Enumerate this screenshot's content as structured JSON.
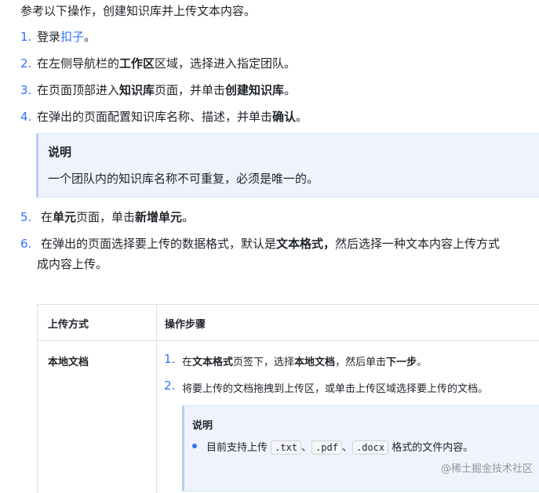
{
  "intro": "参考以下操作，创建知识库并上传文本内容。",
  "steps": [
    {
      "num": "1.",
      "a": "登录",
      "link": "扣子",
      "b": "。"
    },
    {
      "num": "2.",
      "a": "在左侧导航栏的",
      "strong": "工作区",
      "b": "区域，选择进入指定团队。"
    },
    {
      "num": "3.",
      "a": "在页面顶部进入",
      "strong1": "知识库",
      "b": "页面，并单击",
      "strong2": "创建知识库",
      "c": "。"
    },
    {
      "num": "4.",
      "a": "在弹出的页面配置知识库名称、描述，并单击",
      "strong": "确认",
      "b": "。"
    },
    {
      "num": "5.",
      "a": "在",
      "strong1": "单元",
      "b": "页面，单击",
      "strong2": "新增单元",
      "c": "。"
    },
    {
      "num": "6.",
      "a": "在弹出的页面选择要上传的数据格式，默认是",
      "strong": "文本格式，",
      "b": "然后选择一种文本内容上传方式",
      "line2": "成内容上传。"
    }
  ],
  "note": {
    "title": "说明",
    "body": "一个团队内的知识库名称不可重复，必须是唯一的。"
  },
  "table": {
    "headers": [
      "上传方式",
      "操作步骤"
    ],
    "row_label": "本地文档",
    "sub1": {
      "num": "1.",
      "a": "在",
      "s1": "文本格式",
      "b": "页签下，选择",
      "s2": "本地文档",
      "c": "，然后单击",
      "s3": "下一步",
      "d": "。"
    },
    "sub2": {
      "num": "2.",
      "text": "将要上传的文档拖拽到上传区，或单击上传区域选择要上传的文档。"
    },
    "inner_note": {
      "title": "说明",
      "a": "目前支持上传",
      "c1": ".txt",
      "sep1": "、",
      "c2": ".pdf",
      "sep2": "、",
      "c3": ".docx",
      "b": "格式的文件内容。"
    }
  },
  "watermark": "@稀土掘金技术社区"
}
